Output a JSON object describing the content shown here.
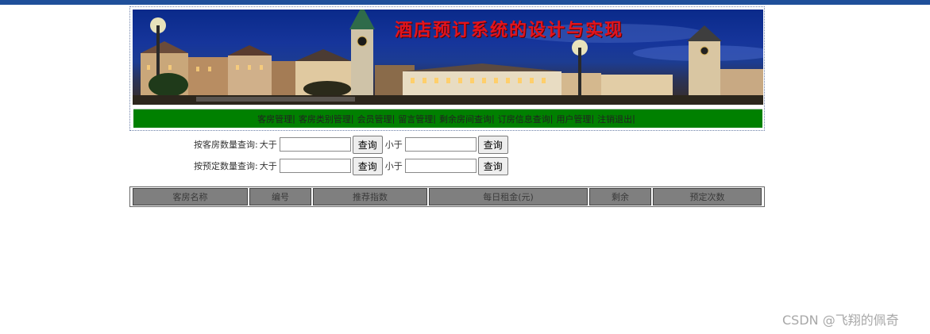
{
  "banner": {
    "title": "酒店预订系统的设计与实现"
  },
  "nav": {
    "items": [
      {
        "label": "客房管理"
      },
      {
        "label": "客房类别管理"
      },
      {
        "label": "会员管理"
      },
      {
        "label": "留言管理"
      },
      {
        "label": "剩余房间查询"
      },
      {
        "label": "订房信息查询"
      },
      {
        "label": "用户管理"
      },
      {
        "label": "注销退出"
      }
    ],
    "separator": "|"
  },
  "query": {
    "rooms": {
      "label": "按客房数量查询:",
      "greater_label": "大于",
      "greater_value": "",
      "less_label": "小于",
      "less_value": "",
      "button": "查询"
    },
    "bookings": {
      "label": "按预定数量查询:",
      "greater_label": "大于",
      "greater_value": "",
      "less_label": "小于",
      "less_value": "",
      "button": "查询"
    }
  },
  "table": {
    "columns": [
      "客房名称",
      "编号",
      "推荐指数",
      "每日租金(元)",
      "剩余",
      "预定次数"
    ]
  },
  "watermark": "CSDN @飞翔的佩奇",
  "colors": {
    "topbar": "#1f4f9a",
    "nav_background": "#008000",
    "header_cell": "#7f7f7f",
    "banner_title": "#e3141c"
  }
}
